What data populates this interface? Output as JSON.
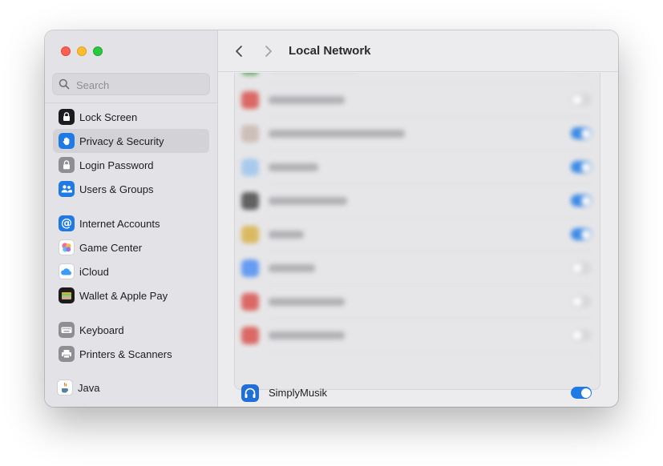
{
  "window": {
    "title": "Local Network"
  },
  "search": {
    "placeholder": "Search"
  },
  "sidebar": {
    "items": [
      {
        "label": "Lock Screen",
        "icon": "lock-screen-icon",
        "color": "#1c1c1e",
        "selected": false
      },
      {
        "label": "Privacy & Security",
        "icon": "hand-icon",
        "color": "#1f7ae6",
        "selected": true
      },
      {
        "label": "Login Password",
        "icon": "lock-icon",
        "color": "#8e8e93",
        "selected": false
      },
      {
        "label": "Users & Groups",
        "icon": "users-icon",
        "color": "#1f7ae6",
        "selected": false
      },
      {
        "label": "Internet Accounts",
        "icon": "at-icon",
        "color": "#1f7ae6",
        "selected": false
      },
      {
        "label": "Game Center",
        "icon": "game-center-icon",
        "color": "#ffffff",
        "selected": false
      },
      {
        "label": "iCloud",
        "icon": "cloud-icon",
        "color": "#ffffff",
        "selected": false
      },
      {
        "label": "Wallet & Apple Pay",
        "icon": "wallet-icon",
        "color": "#1c1c1e",
        "selected": false
      },
      {
        "label": "Keyboard",
        "icon": "keyboard-icon",
        "color": "#8e8e93",
        "selected": false
      },
      {
        "label": "Printers & Scanners",
        "icon": "printer-icon",
        "color": "#8e8e93",
        "selected": false
      },
      {
        "label": "Java",
        "icon": "java-icon",
        "color": "#ffffff",
        "selected": false
      }
    ]
  },
  "apps": {
    "blurred_rows": [
      {
        "icon_color": "#5aa35c",
        "toggle": "off"
      },
      {
        "icon_color": "#d9534f",
        "toggle": "off"
      },
      {
        "icon_color": "#c8b8b0",
        "toggle": "on"
      },
      {
        "icon_color": "#9fc6ee",
        "toggle": "on"
      },
      {
        "icon_color": "#4a4a4a",
        "toggle": "on"
      },
      {
        "icon_color": "#d9b24a",
        "toggle": "on"
      },
      {
        "icon_color": "#4f8ff2",
        "toggle": "off"
      },
      {
        "icon_color": "#d9534f",
        "toggle": "off"
      },
      {
        "icon_color": "#d9534f",
        "toggle": "off"
      }
    ],
    "visible_row": {
      "name": "SimplyMusik",
      "icon": "headphones-icon",
      "toggle": "on"
    }
  },
  "colors": {
    "accent": "#1f7ae6"
  }
}
